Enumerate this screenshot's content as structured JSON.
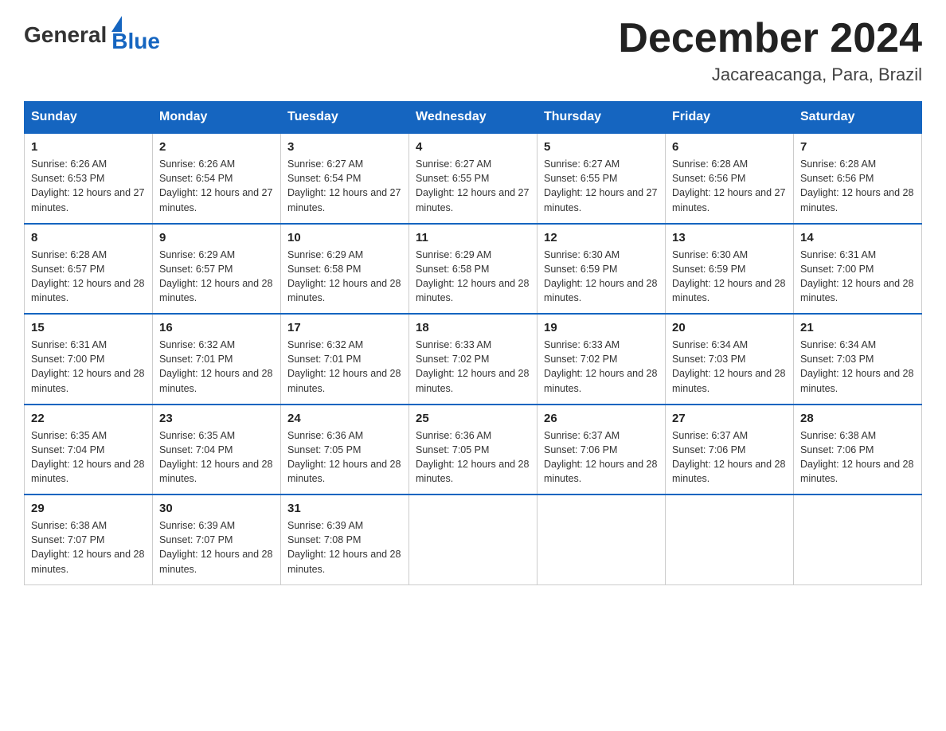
{
  "header": {
    "logo_general": "General",
    "logo_blue": "Blue",
    "month_title": "December 2024",
    "location": "Jacareacanga, Para, Brazil"
  },
  "columns": [
    "Sunday",
    "Monday",
    "Tuesday",
    "Wednesday",
    "Thursday",
    "Friday",
    "Saturday"
  ],
  "weeks": [
    [
      {
        "day": "1",
        "sunrise": "6:26 AM",
        "sunset": "6:53 PM",
        "daylight": "12 hours and 27 minutes."
      },
      {
        "day": "2",
        "sunrise": "6:26 AM",
        "sunset": "6:54 PM",
        "daylight": "12 hours and 27 minutes."
      },
      {
        "day": "3",
        "sunrise": "6:27 AM",
        "sunset": "6:54 PM",
        "daylight": "12 hours and 27 minutes."
      },
      {
        "day": "4",
        "sunrise": "6:27 AM",
        "sunset": "6:55 PM",
        "daylight": "12 hours and 27 minutes."
      },
      {
        "day": "5",
        "sunrise": "6:27 AM",
        "sunset": "6:55 PM",
        "daylight": "12 hours and 27 minutes."
      },
      {
        "day": "6",
        "sunrise": "6:28 AM",
        "sunset": "6:56 PM",
        "daylight": "12 hours and 27 minutes."
      },
      {
        "day": "7",
        "sunrise": "6:28 AM",
        "sunset": "6:56 PM",
        "daylight": "12 hours and 28 minutes."
      }
    ],
    [
      {
        "day": "8",
        "sunrise": "6:28 AM",
        "sunset": "6:57 PM",
        "daylight": "12 hours and 28 minutes."
      },
      {
        "day": "9",
        "sunrise": "6:29 AM",
        "sunset": "6:57 PM",
        "daylight": "12 hours and 28 minutes."
      },
      {
        "day": "10",
        "sunrise": "6:29 AM",
        "sunset": "6:58 PM",
        "daylight": "12 hours and 28 minutes."
      },
      {
        "day": "11",
        "sunrise": "6:29 AM",
        "sunset": "6:58 PM",
        "daylight": "12 hours and 28 minutes."
      },
      {
        "day": "12",
        "sunrise": "6:30 AM",
        "sunset": "6:59 PM",
        "daylight": "12 hours and 28 minutes."
      },
      {
        "day": "13",
        "sunrise": "6:30 AM",
        "sunset": "6:59 PM",
        "daylight": "12 hours and 28 minutes."
      },
      {
        "day": "14",
        "sunrise": "6:31 AM",
        "sunset": "7:00 PM",
        "daylight": "12 hours and 28 minutes."
      }
    ],
    [
      {
        "day": "15",
        "sunrise": "6:31 AM",
        "sunset": "7:00 PM",
        "daylight": "12 hours and 28 minutes."
      },
      {
        "day": "16",
        "sunrise": "6:32 AM",
        "sunset": "7:01 PM",
        "daylight": "12 hours and 28 minutes."
      },
      {
        "day": "17",
        "sunrise": "6:32 AM",
        "sunset": "7:01 PM",
        "daylight": "12 hours and 28 minutes."
      },
      {
        "day": "18",
        "sunrise": "6:33 AM",
        "sunset": "7:02 PM",
        "daylight": "12 hours and 28 minutes."
      },
      {
        "day": "19",
        "sunrise": "6:33 AM",
        "sunset": "7:02 PM",
        "daylight": "12 hours and 28 minutes."
      },
      {
        "day": "20",
        "sunrise": "6:34 AM",
        "sunset": "7:03 PM",
        "daylight": "12 hours and 28 minutes."
      },
      {
        "day": "21",
        "sunrise": "6:34 AM",
        "sunset": "7:03 PM",
        "daylight": "12 hours and 28 minutes."
      }
    ],
    [
      {
        "day": "22",
        "sunrise": "6:35 AM",
        "sunset": "7:04 PM",
        "daylight": "12 hours and 28 minutes."
      },
      {
        "day": "23",
        "sunrise": "6:35 AM",
        "sunset": "7:04 PM",
        "daylight": "12 hours and 28 minutes."
      },
      {
        "day": "24",
        "sunrise": "6:36 AM",
        "sunset": "7:05 PM",
        "daylight": "12 hours and 28 minutes."
      },
      {
        "day": "25",
        "sunrise": "6:36 AM",
        "sunset": "7:05 PM",
        "daylight": "12 hours and 28 minutes."
      },
      {
        "day": "26",
        "sunrise": "6:37 AM",
        "sunset": "7:06 PM",
        "daylight": "12 hours and 28 minutes."
      },
      {
        "day": "27",
        "sunrise": "6:37 AM",
        "sunset": "7:06 PM",
        "daylight": "12 hours and 28 minutes."
      },
      {
        "day": "28",
        "sunrise": "6:38 AM",
        "sunset": "7:06 PM",
        "daylight": "12 hours and 28 minutes."
      }
    ],
    [
      {
        "day": "29",
        "sunrise": "6:38 AM",
        "sunset": "7:07 PM",
        "daylight": "12 hours and 28 minutes."
      },
      {
        "day": "30",
        "sunrise": "6:39 AM",
        "sunset": "7:07 PM",
        "daylight": "12 hours and 28 minutes."
      },
      {
        "day": "31",
        "sunrise": "6:39 AM",
        "sunset": "7:08 PM",
        "daylight": "12 hours and 28 minutes."
      },
      null,
      null,
      null,
      null
    ]
  ]
}
